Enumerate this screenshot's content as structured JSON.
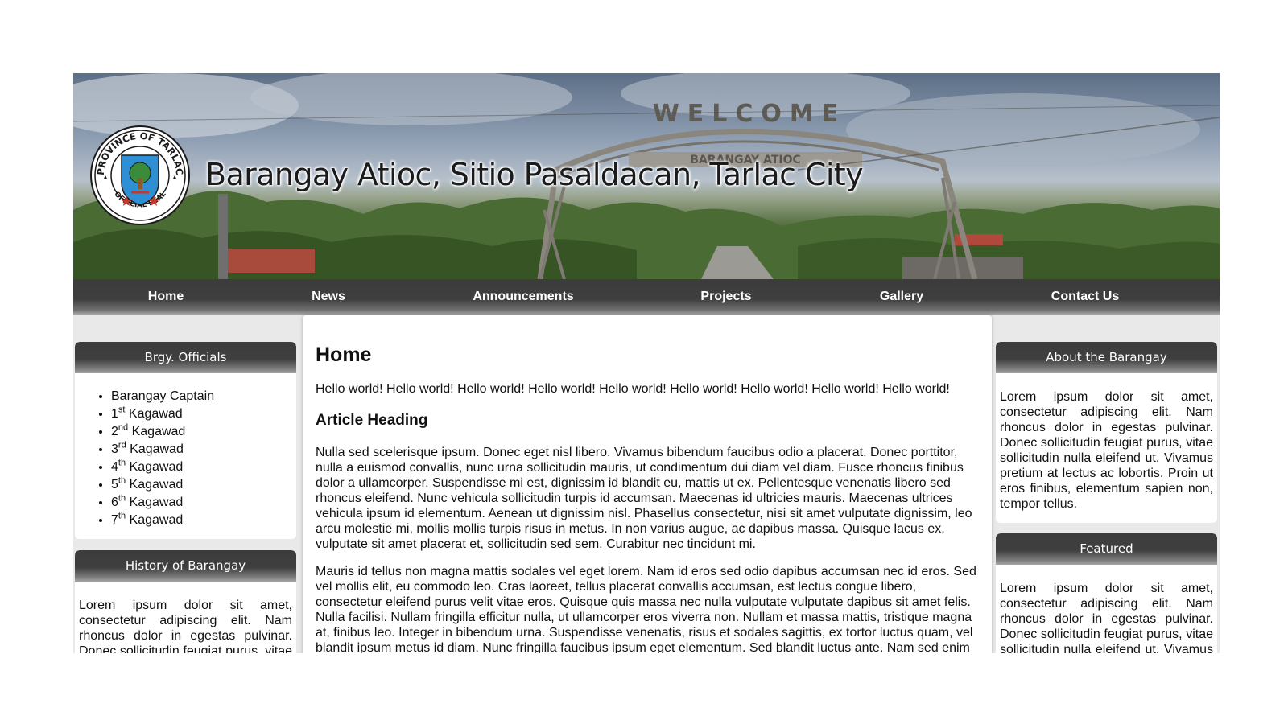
{
  "header": {
    "title": "Barangay Atioc, Sitio Pasaldacan, Tarlac City",
    "seal": {
      "icon": "official-seal-icon",
      "top_text": "PROVINCE OF TARLAC",
      "bottom_text": "OFFICIAL SEAL"
    },
    "arch_text": "WELCOME",
    "arch_sign": "BARANGAY ATIOC"
  },
  "nav": {
    "items": [
      {
        "label": "Home"
      },
      {
        "label": "News"
      },
      {
        "label": "Announcements"
      },
      {
        "label": "Projects"
      },
      {
        "label": "Gallery"
      },
      {
        "label": "Contact Us"
      }
    ]
  },
  "left_sidebar": {
    "officials": {
      "heading": "Brgy. Officials",
      "items": [
        {
          "label": "Barangay Captain",
          "num": "",
          "sup": ""
        },
        {
          "label": "Kagawad",
          "num": "1",
          "sup": "st"
        },
        {
          "label": "Kagawad",
          "num": "2",
          "sup": "nd"
        },
        {
          "label": "Kagawad",
          "num": "3",
          "sup": "rd"
        },
        {
          "label": "Kagawad",
          "num": "4",
          "sup": "th"
        },
        {
          "label": "Kagawad",
          "num": "5",
          "sup": "th"
        },
        {
          "label": "Kagawad",
          "num": "6",
          "sup": "th"
        },
        {
          "label": "Kagawad",
          "num": "7",
          "sup": "th"
        }
      ]
    },
    "history": {
      "heading": "History of Barangay",
      "text": "Lorem ipsum dolor sit amet, consectetur adipiscing elit. Nam rhoncus dolor in egestas pulvinar. Donec sollicitudin feugiat purus, vitae sollicitudin nulla eleifend ut. Vivamus pretium at lectus ac lobortis. Proin ut eros finibus, elementum sapien non, tempor tellus."
    }
  },
  "main": {
    "title": "Home",
    "intro": "Hello world! Hello world! Hello world! Hello world! Hello world! Hello world! Hello world! Hello world! Hello world!",
    "article_heading": "Article Heading",
    "paragraphs": [
      "Nulla sed scelerisque ipsum. Donec eget nisl libero. Vivamus bibendum faucibus odio a placerat. Donec porttitor, nulla a euismod convallis, nunc urna sollicitudin mauris, ut condimentum dui diam vel diam. Fusce rhoncus finibus dolor a ullamcorper. Suspendisse mi est, dignissim id blandit eu, mattis ut ex. Pellentesque venenatis libero sed rhoncus eleifend. Nunc vehicula sollicitudin turpis id accumsan. Maecenas id ultricies mauris. Maecenas ultrices vehicula ipsum id elementum. Aenean ut dignissim nisl. Phasellus consectetur, nisi sit amet vulputate dignissim, leo arcu molestie mi, mollis mollis turpis risus in metus. In non varius augue, ac dapibus massa. Quisque lacus ex, vulputate sit amet placerat et, sollicitudin sed sem. Curabitur nec tincidunt mi.",
      "Mauris id tellus non magna mattis sodales vel eget lorem. Nam id eros sed odio dapibus accumsan nec id eros. Sed vel mollis elit, eu commodo leo. Cras laoreet, tellus placerat convallis accumsan, est lectus congue libero, consectetur eleifend purus velit vitae eros. Quisque quis massa nec nulla vulputate vulputate dapibus sit amet felis. Nulla facilisi. Nullam fringilla efficitur nulla, ut ullamcorper eros viverra non. Nullam et massa mattis, tristique magna at, finibus leo. Integer in bibendum urna. Suspendisse venenatis, risus et sodales sagittis, ex tortor luctus quam, vel blandit ipsum metus id diam. Nunc fringilla faucibus ipsum eget elementum. Sed blandit luctus ante. Nam sed enim"
    ]
  },
  "right_sidebar": {
    "about": {
      "heading": "About the Barangay",
      "text": "Lorem ipsum dolor sit amet, consectetur adipiscing elit. Nam rhoncus dolor in egestas pulvinar. Donec sollicitudin feugiat purus, vitae sollicitudin nulla eleifend ut. Vivamus pretium at lectus ac lobortis. Proin ut eros finibus, elementum sapien non, tempor tellus."
    },
    "featured": {
      "heading": "Featured",
      "text": "Lorem ipsum dolor sit amet, consectetur adipiscing elit. Nam rhoncus dolor in egestas pulvinar. Donec sollicitudin feugiat purus, vitae sollicitudin nulla eleifend ut. Vivamus pretium at lectus ac lobortis. Proin ut eros finibus, elementum sapien non, tempor tellus."
    }
  },
  "colors": {
    "nav_bg": "#3c3c3c",
    "nav_text": "#ffffff",
    "page_bg": "#e9e9e9",
    "panel_bg": "#ffffff",
    "seal_blue": "#2f8fd4",
    "seal_red": "#c0392b"
  }
}
